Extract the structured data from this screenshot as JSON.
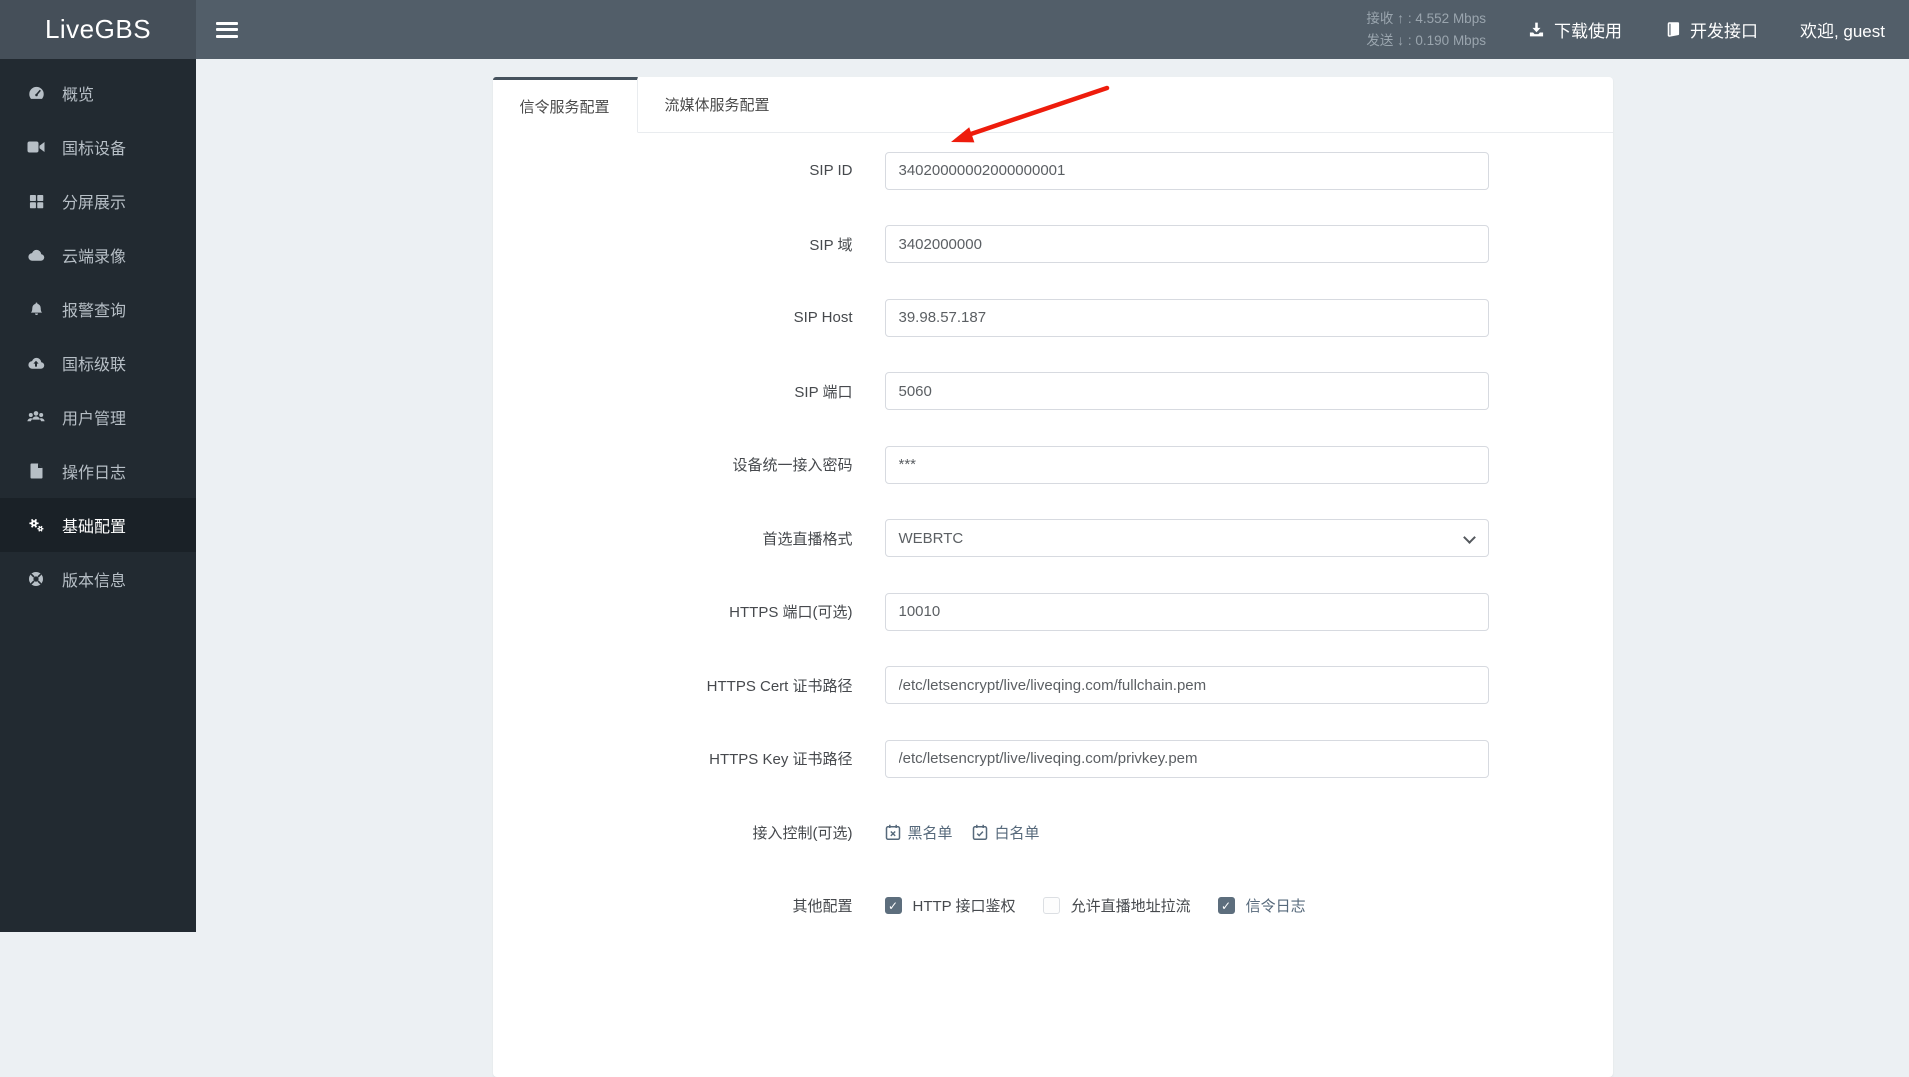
{
  "navbar": {
    "logo": "LiveGBS",
    "stats": {
      "recv_label": "接收",
      "recv_arrow": "↑",
      "recv_sep": ":",
      "recv_value": "4.552 Mbps",
      "send_label": "发送",
      "send_arrow": "↓",
      "send_sep": ":",
      "send_value": "0.190 Mbps"
    },
    "download_label": "下载使用",
    "api_label": "开发接口",
    "greeting": "欢迎, guest"
  },
  "sidebar": {
    "items": [
      {
        "id": "overview",
        "label": "概览",
        "icon": "dashboard-icon",
        "active": false
      },
      {
        "id": "gb-devices",
        "label": "国标设备",
        "icon": "camera-icon",
        "active": false
      },
      {
        "id": "split-screen",
        "label": "分屏展示",
        "icon": "grid-icon",
        "active": false
      },
      {
        "id": "cloud-record",
        "label": "云端录像",
        "icon": "cloud-icon",
        "active": false
      },
      {
        "id": "alarm-query",
        "label": "报警查询",
        "icon": "bell-icon",
        "active": false
      },
      {
        "id": "gb-cascade",
        "label": "国标级联",
        "icon": "cloud-upload-icon",
        "active": false
      },
      {
        "id": "user-mgmt",
        "label": "用户管理",
        "icon": "users-icon",
        "active": false
      },
      {
        "id": "op-logs",
        "label": "操作日志",
        "icon": "file-icon",
        "active": false
      },
      {
        "id": "basic-config",
        "label": "基础配置",
        "icon": "gears-icon",
        "active": true
      },
      {
        "id": "version-info",
        "label": "版本信息",
        "icon": "info-icon",
        "active": false
      }
    ]
  },
  "tabs": [
    {
      "id": "signal-config",
      "label": "信令服务配置",
      "active": true
    },
    {
      "id": "media-config",
      "label": "流媒体服务配置",
      "active": false
    }
  ],
  "form": {
    "rows": [
      {
        "type": "text",
        "name": "sip-id",
        "label": "SIP ID",
        "value": "34020000002000000001"
      },
      {
        "type": "text",
        "name": "sip-domain",
        "label": "SIP 域",
        "value": "3402000000"
      },
      {
        "type": "text",
        "name": "sip-host",
        "label": "SIP Host",
        "value": "39.98.57.187"
      },
      {
        "type": "text",
        "name": "sip-port",
        "label": "SIP 端口",
        "value": "5060"
      },
      {
        "type": "text",
        "name": "device-password",
        "label": "设备统一接入密码",
        "value": "***"
      },
      {
        "type": "select",
        "name": "preferred-live-format",
        "label": "首选直播格式",
        "value": "WEBRTC"
      },
      {
        "type": "text",
        "name": "https-port",
        "label": "HTTPS 端口(可选)",
        "value": "10010"
      },
      {
        "type": "text",
        "name": "https-cert-path",
        "label": "HTTPS Cert 证书路径",
        "value": "/etc/letsencrypt/live/liveqing.com/fullchain.pem"
      },
      {
        "type": "text",
        "name": "https-key-path",
        "label": "HTTPS Key 证书路径",
        "value": "/etc/letsencrypt/live/liveqing.com/privkey.pem"
      },
      {
        "type": "links",
        "name": "access-control",
        "label": "接入控制(可选)",
        "links": [
          {
            "name": "blacklist-link",
            "label": "黑名单",
            "icon": "calendar-x-icon"
          },
          {
            "name": "whitelist-link",
            "label": "白名单",
            "icon": "calendar-check-icon"
          }
        ]
      },
      {
        "type": "checkboxes",
        "name": "other-config",
        "label": "其他配置",
        "checkboxes": [
          {
            "name": "http-api-auth-checkbox",
            "label": "HTTP 接口鉴权",
            "checked": true,
            "highlight": false
          },
          {
            "name": "allow-pull-checkbox",
            "label": "允许直播地址拉流",
            "checked": false,
            "highlight": false
          },
          {
            "name": "signal-log-checkbox",
            "label": "信令日志",
            "checked": true,
            "highlight": true
          }
        ]
      }
    ]
  },
  "annotation": {
    "arrow_color": "#ee1c0c"
  },
  "colors": {
    "navbar_bg": "#525e69",
    "logo_bg": "#454f59",
    "sidebar_bg": "#222a31",
    "sidebar_active_bg": "#1a2127",
    "link_slate": "#56697b",
    "checkbox_checked": "#5d6e7d"
  }
}
